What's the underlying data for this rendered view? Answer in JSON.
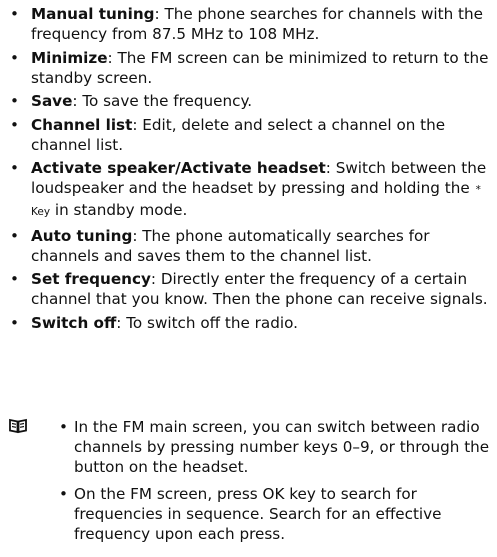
{
  "items": [
    {
      "term": "Manual tuning",
      "text": ": The phone searches for channels with the frequency from 87.5 MHz to 108 MHz."
    },
    {
      "term": "Minimize",
      "text": ": The FM screen can be minimized to return to the standby screen."
    },
    {
      "term": "Save",
      "text": ": To save the frequency."
    },
    {
      "term": "Channel list",
      "text": ": Edit, delete and select a channel on the channel list."
    },
    {
      "term": "Activate speaker/Activate headset",
      "text": ": Switch between the loudspeaker and the headset by pressing and holding the",
      "key": "* Key",
      "text_after": "in standby mode."
    },
    {
      "term": "Auto tuning",
      "text": ": The phone automatically searches for channels and saves them to the channel list."
    },
    {
      "term": "Set frequency",
      "text": ": Directly enter the frequency of a certain channel that you know. Then the phone can receive signals."
    },
    {
      "term": "Switch off",
      "text": ": To switch off the radio."
    }
  ],
  "note_icon": "open-book-icon",
  "notes": [
    "In the FM main screen, you can switch between radio channels by pressing number keys 0–9, or through the button on the headset.",
    "On the FM screen, press OK key to search for frequencies in sequence. Search for an effective frequency upon each press."
  ]
}
